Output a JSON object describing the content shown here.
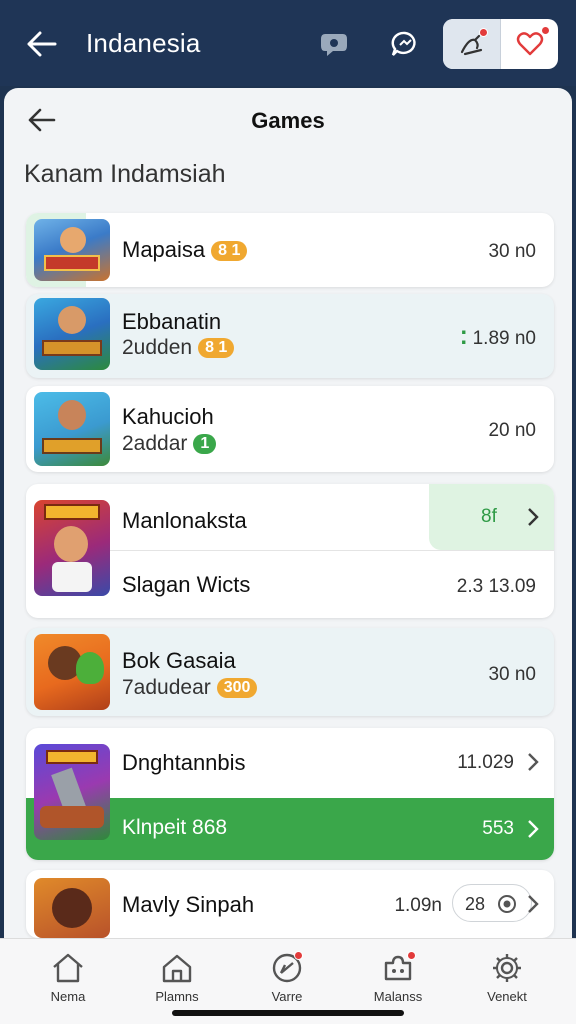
{
  "topbar": {
    "title": "Indanesia"
  },
  "screen": {
    "title": "Games",
    "section": "Kanam Indamsiah"
  },
  "games": [
    {
      "name": "Mapaisa",
      "badge": "8 1",
      "value": "30 n0"
    },
    {
      "name": "Ebbanatin",
      "sub": "2udden",
      "badge": "8 1",
      "value": "1.89 n0"
    },
    {
      "name": "Kahucioh",
      "sub": "2addar",
      "badge": "1",
      "value": "20 n0"
    },
    {
      "name": "Manlonaksta",
      "action_value": "8f",
      "sub_title": "Slagan Wicts",
      "sub_value": "2.3 13.09"
    },
    {
      "name": "Bok Gasaia",
      "sub": "7adudear",
      "badge": "300",
      "value": "30 n0"
    },
    {
      "name": "Dnghtannbis",
      "value": "11.029",
      "promo_label": "Klnpeit 868",
      "promo_value": "553"
    },
    {
      "name": "Mavly Sinpah",
      "value": "1.09n",
      "pill_value": "28"
    }
  ],
  "nav": [
    {
      "label": "Nema"
    },
    {
      "label": "Plamns"
    },
    {
      "label": "Varre"
    },
    {
      "label": "Malanss"
    },
    {
      "label": "Venekt"
    }
  ],
  "colors": {
    "header": "#1f3556",
    "accent_green": "#3aa74a",
    "badge_orange": "#f0a830",
    "notification": "#e23b3b"
  }
}
